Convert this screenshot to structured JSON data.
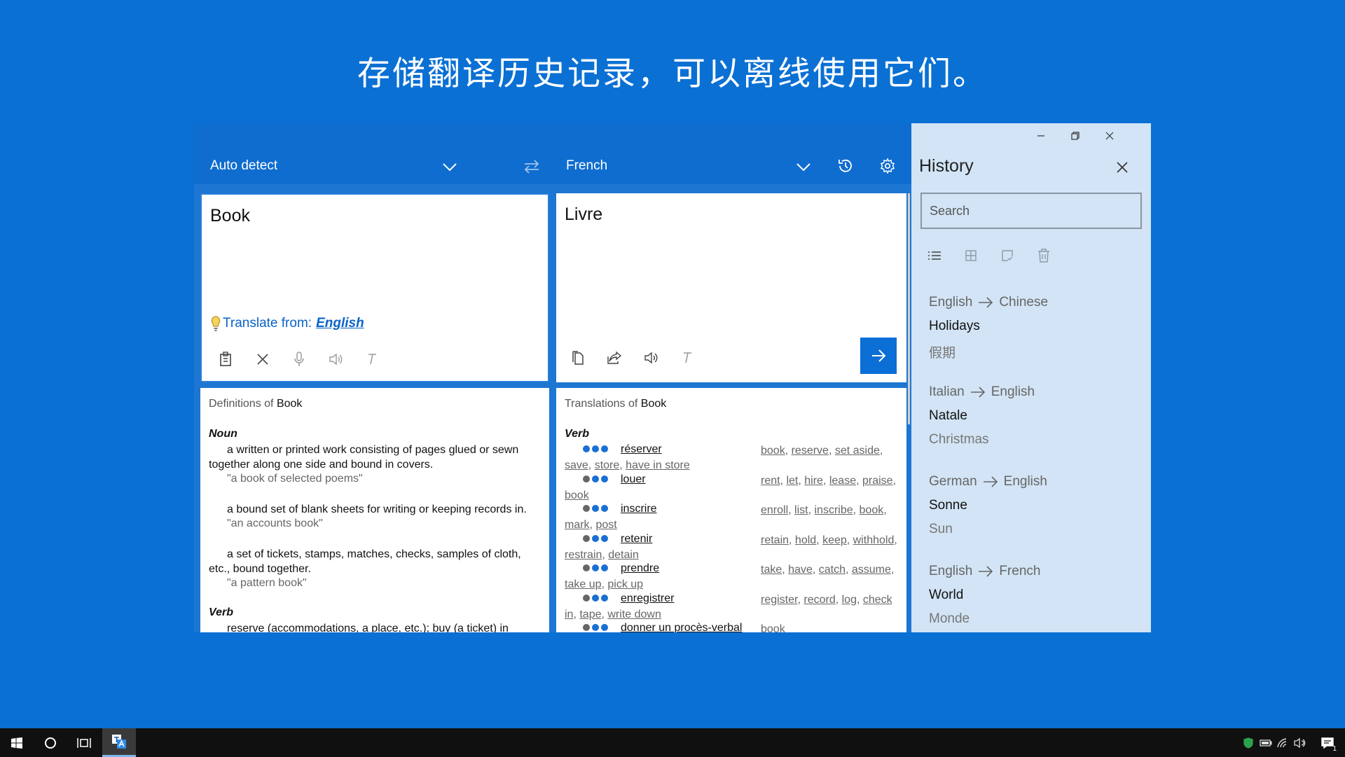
{
  "headline": "存储翻译历史记录，可以离线使用它们。",
  "lang_bar": {
    "source_language": "Auto detect",
    "target_language": "French",
    "icons": [
      "chevron-down-icon",
      "swap-icon",
      "history-icon",
      "settings-gear-icon"
    ]
  },
  "source_editor": {
    "text": "Book",
    "suggestion_prefix": "Translate from:",
    "suggestion_language": "English",
    "tools": [
      "paste-icon",
      "clear-icon",
      "microphone-icon",
      "speaker-icon",
      "font-icon"
    ]
  },
  "target_editor": {
    "text": "Livre",
    "tools": [
      "copy-icon",
      "share-icon",
      "speaker-icon",
      "font-icon",
      "arrow-right-icon"
    ]
  },
  "definitions": {
    "heading_prefix": "Definitions of",
    "heading_word": "Book",
    "noun_label": "Noun",
    "entries": [
      {
        "text": "a written or printed work consisting of pages glued or sewn together along one side and bound in covers.",
        "example": "\"a book of selected poems\""
      },
      {
        "text": "a bound set of blank sheets for writing or keeping records in.",
        "example": "\"an accounts book\""
      },
      {
        "text": "a set of tickets, stamps, matches, checks, samples of cloth, etc., bound together.",
        "example": "\"a pattern book\""
      }
    ],
    "verb_label": "Verb",
    "verb_entry": "reserve (accommodations, a place, etc.); buy (a ticket) in"
  },
  "translations": {
    "heading_prefix": "Translations of",
    "heading_word": "Book",
    "pos_label": "Verb",
    "rows": [
      {
        "word": "réserver",
        "strength": 3,
        "back": [
          "book",
          "reserve",
          "set aside",
          "save",
          "store",
          "have in store"
        ]
      },
      {
        "word": "louer",
        "strength": 2,
        "back": [
          "rent",
          "let",
          "hire",
          "lease",
          "praise",
          "book"
        ]
      },
      {
        "word": "inscrire",
        "strength": 2,
        "back": [
          "enroll",
          "list",
          "inscribe",
          "book",
          "mark",
          "post"
        ]
      },
      {
        "word": "retenir",
        "strength": 2,
        "back": [
          "retain",
          "hold",
          "keep",
          "withhold",
          "restrain",
          "detain"
        ]
      },
      {
        "word": "prendre",
        "strength": 2,
        "back": [
          "take",
          "have",
          "catch",
          "assume",
          "take up",
          "pick up"
        ]
      },
      {
        "word": "enregistrer",
        "strength": 2,
        "back": [
          "register",
          "record",
          "log",
          "check in",
          "tape",
          "write down"
        ]
      },
      {
        "word": "donner un procès-verbal",
        "strength": 2,
        "back": [
          "book"
        ]
      }
    ]
  },
  "history": {
    "title": "History",
    "search_placeholder": "Search",
    "toolbar_icons": [
      "list-view-icon",
      "grid-view-icon",
      "select-icon",
      "delete-icon"
    ],
    "items": [
      {
        "from": "English",
        "to": "Chinese",
        "source": "Holidays",
        "result": "假期"
      },
      {
        "from": "Italian",
        "to": "English",
        "source": "Natale",
        "result": "Christmas"
      },
      {
        "from": "German",
        "to": "English",
        "source": "Sonne",
        "result": "Sun"
      },
      {
        "from": "English",
        "to": "French",
        "source": "World",
        "result": "Monde"
      }
    ]
  },
  "taskbar": {
    "icons": [
      "windows-start-icon",
      "cortana-icon",
      "task-view-icon",
      "translator-app-icon"
    ],
    "tray_icons": [
      "shield-icon",
      "battery-icon",
      "wifi-icon",
      "volume-icon",
      "notification-icon"
    ],
    "notification_count": "1"
  }
}
